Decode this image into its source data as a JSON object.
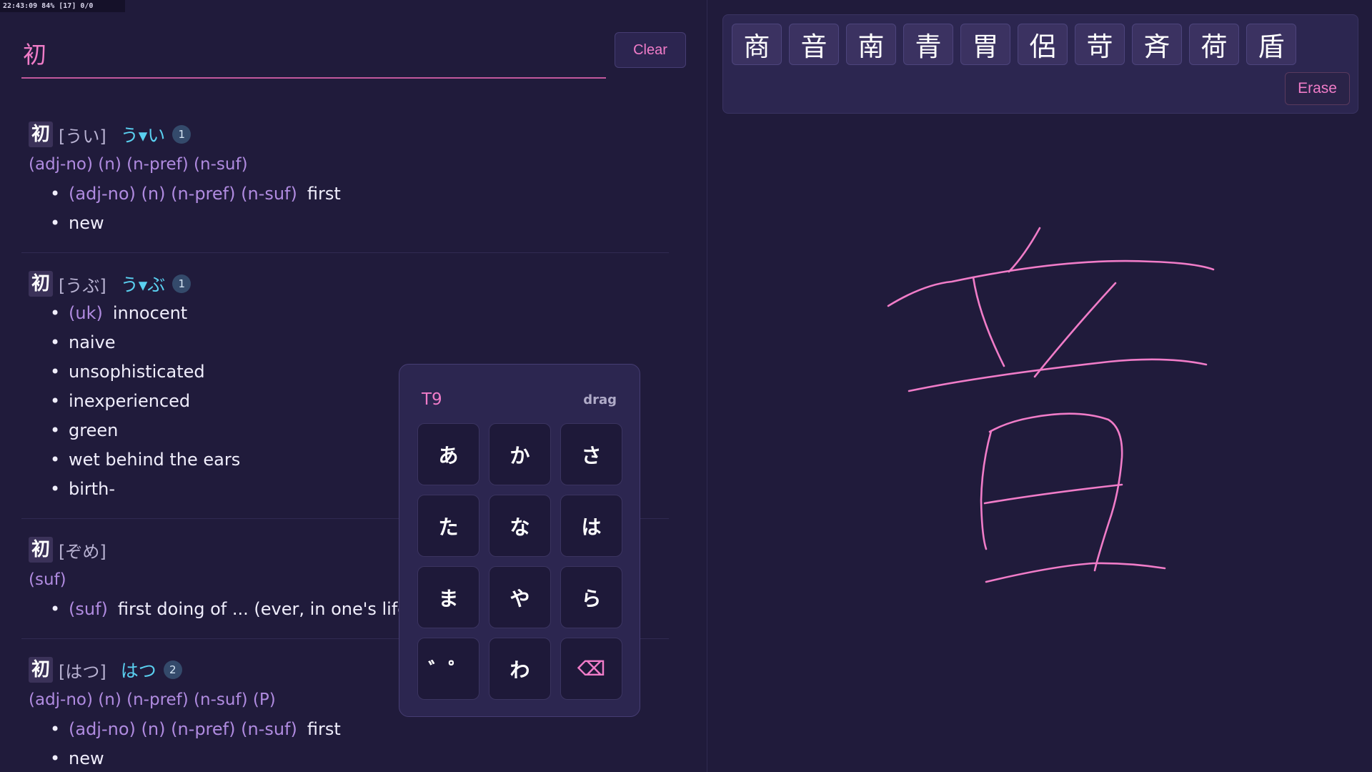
{
  "status": "22:43:09 84% [17] 0/0",
  "search": {
    "value": "初",
    "clear_label": "Clear"
  },
  "entries": [
    {
      "kanji": "初",
      "reading": "[うい]",
      "kana": "う▾い",
      "count": "1",
      "pos": "(adj-no) (n) (n-pref) (n-suf)",
      "senses": [
        {
          "tag": "(adj-no) (n) (n-pref) (n-suf)",
          "text": "first"
        },
        {
          "tag": "",
          "text": "new"
        }
      ]
    },
    {
      "kanji": "初",
      "reading": "[うぶ]",
      "kana": "う▾ぶ",
      "count": "1",
      "pos": "",
      "senses": [
        {
          "tag": "(uk)",
          "text": "innocent"
        },
        {
          "tag": "",
          "text": "naive"
        },
        {
          "tag": "",
          "text": "unsophisticated"
        },
        {
          "tag": "",
          "text": "inexperienced"
        },
        {
          "tag": "",
          "text": "green"
        },
        {
          "tag": "",
          "text": "wet behind the ears"
        },
        {
          "tag": "",
          "text": "birth-"
        }
      ]
    },
    {
      "kanji": "初",
      "reading": "[ぞめ]",
      "kana": "",
      "count": "",
      "pos": "(suf)",
      "senses": [
        {
          "tag": "(suf)",
          "text": "first doing of ... (ever, in one's life, in"
        }
      ]
    },
    {
      "kanji": "初",
      "reading": "[はつ]",
      "kana": "はつ",
      "count": "2",
      "pos": "(adj-no) (n) (n-pref) (n-suf) (P)",
      "senses": [
        {
          "tag": "(adj-no) (n) (n-pref) (n-suf)",
          "text": "first"
        },
        {
          "tag": "",
          "text": "new"
        }
      ]
    }
  ],
  "t9": {
    "title": "T9",
    "drag_label": "drag",
    "keys": [
      "あ",
      "か",
      "さ",
      "た",
      "な",
      "は",
      "ま",
      "や",
      "ら",
      "゛゜",
      "わ",
      "⌫"
    ]
  },
  "candidates": [
    "商",
    "音",
    "南",
    "青",
    "胃",
    "侶",
    "苛",
    "斉",
    "荷",
    "盾"
  ],
  "erase_label": "Erase",
  "colors": {
    "accent": "#f07cc8",
    "kana": "#5ad0f0",
    "pos": "#b08be0",
    "background": "#201b3b"
  }
}
